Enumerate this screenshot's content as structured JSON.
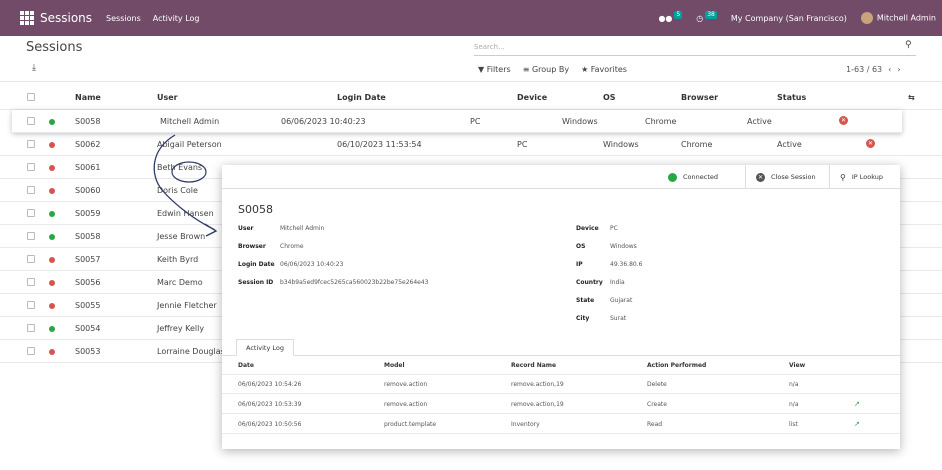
{
  "navbar": {
    "app_name": "Sessions",
    "menu": [
      "Sessions",
      "Activity Log"
    ],
    "messages_count": "5",
    "activity_count": "38",
    "company": "My Company (San Francisco)",
    "user": "Mitchell Admin",
    "color": "#714b67"
  },
  "control_panel": {
    "title": "Sessions",
    "search_placeholder": "Search...",
    "filters": "Filters",
    "group_by": "Group By",
    "favorites": "Favorites",
    "pager": "1-63 / 63"
  },
  "list": {
    "headers": {
      "name": "Name",
      "user": "User",
      "login_date": "Login Date",
      "device": "Device",
      "os": "OS",
      "browser": "Browser",
      "status": "Status"
    },
    "selected": {
      "name": "S0058",
      "user": "Mitchell Admin",
      "login_date": "06/06/2023 10:40:23",
      "device": "PC",
      "os": "Windows",
      "browser": "Chrome",
      "status": "Active"
    },
    "rows": [
      {
        "name": "S0062",
        "user": "Abigail Peterson",
        "login_date": "06/10/2023 11:53:54",
        "device": "PC",
        "os": "Windows",
        "browser": "Chrome",
        "status": "Active",
        "dot": "#d9534f",
        "close": true
      },
      {
        "name": "S0061",
        "user": "Beth Evans",
        "login_date": "",
        "device": "",
        "os": "",
        "browser": "",
        "status": "",
        "dot": "#d9534f",
        "close": false
      },
      {
        "name": "S0060",
        "user": "Doris Cole",
        "dot": "#d9534f"
      },
      {
        "name": "S0059",
        "user": "Edwin Hansen",
        "dot": "#28a745"
      },
      {
        "name": "S0058",
        "user": "Jesse Brown",
        "dot": "#28a745"
      },
      {
        "name": "S0057",
        "user": "Keith Byrd",
        "dot": "#d9534f"
      },
      {
        "name": "S0056",
        "user": "Marc Demo",
        "dot": "#d9534f"
      },
      {
        "name": "S0055",
        "user": "Jennie Fletcher",
        "dot": "#d9534f"
      },
      {
        "name": "S0054",
        "user": "Jeffrey Kelly",
        "dot": "#28a745"
      },
      {
        "name": "S0053",
        "user": "Lorraine Douglas",
        "dot": "#d9534f"
      }
    ]
  },
  "popup": {
    "connected": "Connected",
    "close_session": "Close Session",
    "ip_lookup": "IP Lookup",
    "name": "S0058",
    "fields_left": [
      {
        "label": "User",
        "value": "Mitchell Admin"
      },
      {
        "label": "Browser",
        "value": "Chrome"
      },
      {
        "label": "Login Date",
        "value": "06/06/2023 10:40:23"
      },
      {
        "label": "Session ID",
        "value": "b34b9a5ed9fcec5265ca560023b22be75e264e43"
      }
    ],
    "fields_right": [
      {
        "label": "Device",
        "value": "PC"
      },
      {
        "label": "OS",
        "value": "Windows"
      },
      {
        "label": "IP",
        "value": "49.36.80.6"
      },
      {
        "label": "Country",
        "value": "India"
      },
      {
        "label": "State",
        "value": "Gujarat"
      },
      {
        "label": "City",
        "value": "Surat"
      }
    ],
    "tab": "Activity Log",
    "log_headers": {
      "date": "Date",
      "model": "Model",
      "record": "Record Name",
      "action": "Action Performed",
      "view": "View"
    },
    "log_rows": [
      {
        "date": "06/06/2023 10:54:26",
        "model": "remove.action",
        "record": "remove.action,19",
        "action": "Delete",
        "view": "n/a",
        "link": false
      },
      {
        "date": "06/06/2023 10:53:39",
        "model": "remove.action",
        "record": "remove.action,19",
        "action": "Create",
        "view": "n/a",
        "link": true
      },
      {
        "date": "06/06/2023 10:50:56",
        "model": "product.template",
        "record": "Inventory",
        "action": "Read",
        "view": "list",
        "link": true
      }
    ]
  }
}
